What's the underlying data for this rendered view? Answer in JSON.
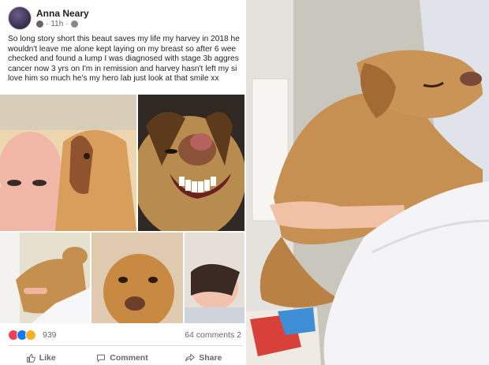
{
  "post": {
    "author": "Anna Neary",
    "time": "11h",
    "text_lines": [
      "So long story short this beaut saves my life my harvey in 2018 he",
      "wouldn't leave me alone kept laying on my breast so after 6 wee",
      "checked and found a lump I was diagnosed with stage 3b aggres",
      "cancer now 3 yrs on I'm in remission and harvey hasn't left my si",
      "love him so much he's my hero lab just look at that smile  xx"
    ]
  },
  "stats": {
    "reaction_count": "939",
    "comments": "64 comments",
    "shares_partial": "2"
  },
  "actions": {
    "like": "Like",
    "comment": "Comment",
    "share": "Share"
  },
  "colors": {
    "like_blue": "#1877f2",
    "love_red": "#f33e58",
    "haha_yellow": "#f7b125",
    "text_gray": "#65676b"
  },
  "icons": [
    "friends-icon",
    "like-reaction-icon",
    "love-reaction-icon",
    "haha-reaction-icon",
    "like-icon",
    "comment-icon",
    "share-icon"
  ]
}
